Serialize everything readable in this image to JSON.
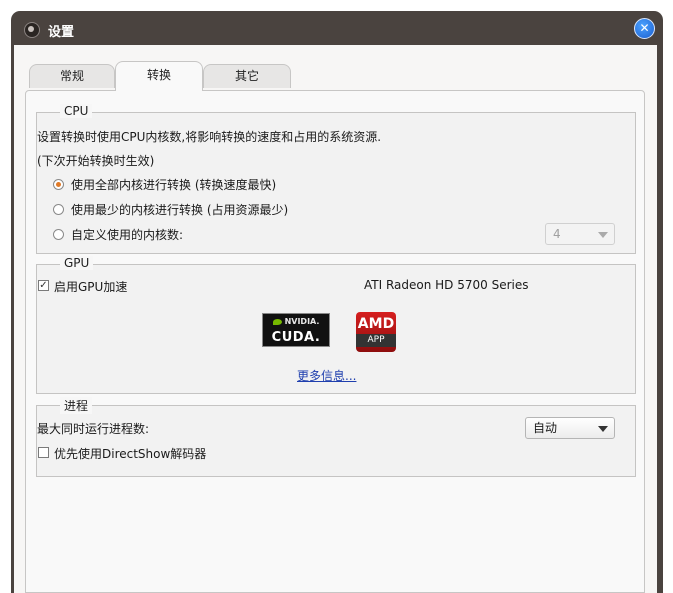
{
  "window": {
    "title": "设置"
  },
  "tabs": [
    {
      "label": "常规"
    },
    {
      "label": "转换"
    },
    {
      "label": "其它"
    }
  ],
  "cpu": {
    "title": "CPU",
    "description": "设置转换时使用CPU内核数,将影响转换的速度和占用的系统资源.",
    "note": "(下次开始转换时生效)",
    "options": [
      {
        "label": "使用全部内核进行转换 (转换速度最快)",
        "selected": true
      },
      {
        "label": "使用最少的内核进行转换 (占用资源最少)",
        "selected": false
      },
      {
        "label": "自定义使用的内核数:",
        "selected": false
      }
    ],
    "core_count": "4"
  },
  "gpu": {
    "title": "GPU",
    "enable_label": "启用GPU加速",
    "enabled": true,
    "device_name": "ATI Radeon HD 5700 Series",
    "nvidia_logo": {
      "brand": "NVIDIA.",
      "product": "CUDA."
    },
    "amd_logo": {
      "brand": "AMD",
      "product": "APP"
    },
    "more_info": "更多信息..."
  },
  "process": {
    "title": "进程",
    "max_label": "最大同时运行进程数:",
    "max_value": "自动",
    "directshow_label": "优先使用DirectShow解码器",
    "directshow_checked": false
  },
  "colors": {
    "frame": "#4a433f",
    "accent_radio": "#e07a28",
    "link": "#1f3fae",
    "close_button": "#2a7de8"
  }
}
